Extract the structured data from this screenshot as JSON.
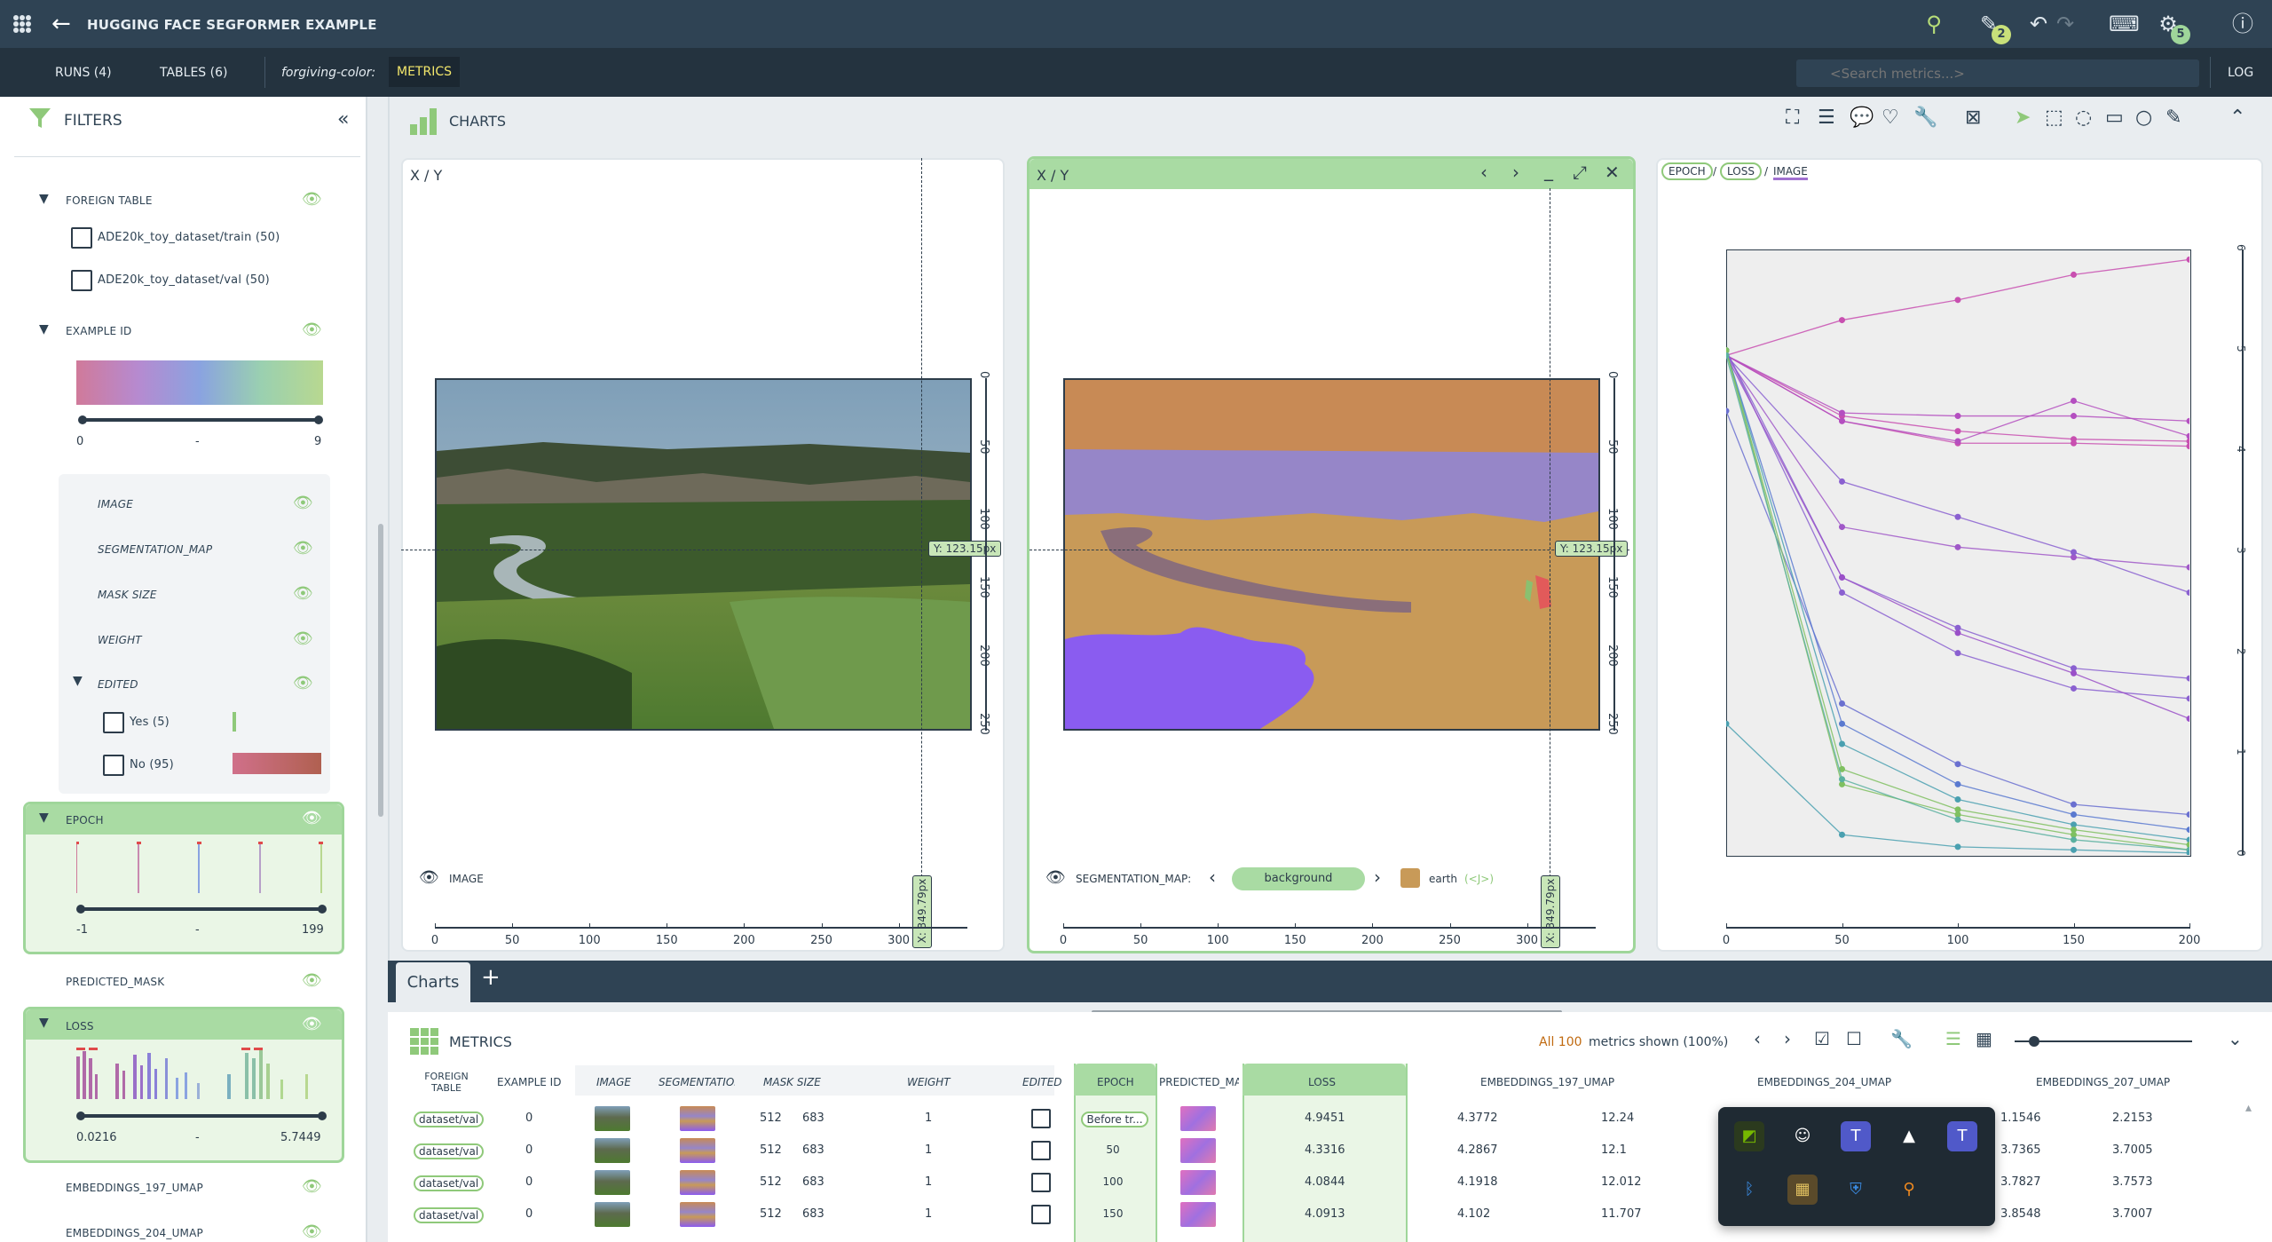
{
  "app": {
    "title": "HUGGING FACE SEGFORMER EXAMPLE",
    "badge_edits": "2",
    "badge_tasks": "5"
  },
  "subbar": {
    "runs": "RUNS (4)",
    "tables": "TABLES (6)",
    "coloring_label": "forgiving-color:",
    "coloring_value": "METRICS",
    "search_placeholder": "<Search metrics...>",
    "log": "LOG"
  },
  "filters": {
    "title": "FILTERS",
    "foreign_table": {
      "label": "FOREIGN TABLE",
      "options": [
        "ADE20k_toy_dataset/train (50)",
        "ADE20k_toy_dataset/val (50)"
      ]
    },
    "example_id": {
      "label": "EXAMPLE ID",
      "min": "0",
      "sep": "-",
      "max": "9"
    },
    "columns": [
      "IMAGE",
      "SEGMENTATION_MAP",
      "MASK SIZE",
      "WEIGHT"
    ],
    "edited": {
      "label": "EDITED",
      "yes": "Yes (5)",
      "no": "No (95)"
    },
    "epoch": {
      "label": "EPOCH",
      "min": "-1",
      "sep": "-",
      "max": "199"
    },
    "predicted_mask": "PREDICTED_MASK",
    "loss": {
      "label": "LOSS",
      "min": "0.0216",
      "sep": "-",
      "max": "5.7449"
    },
    "emb197": "EMBEDDINGS_197_UMAP",
    "emb204": "EMBEDDINGS_204_UMAP"
  },
  "charts": {
    "title": "CHARTS",
    "panel1": {
      "title": "X / Y",
      "legend": "IMAGE",
      "x_ticks": [
        "0",
        "50",
        "100",
        "150",
        "200",
        "250",
        "300"
      ],
      "y_ticks": [
        "0",
        "50",
        "100",
        "150",
        "200",
        "250"
      ],
      "cursor_x": "X: 349.79px",
      "cursor_y": "Y: 123.15px"
    },
    "panel2": {
      "title": "X / Y",
      "legend": "SEGMENTATION_MAP:",
      "class_selected": "background",
      "class_next": "earth",
      "class_next_tag": "(<J>)",
      "x_ticks": [
        "0",
        "50",
        "100",
        "150",
        "200",
        "250",
        "300"
      ],
      "y_ticks": [
        "0",
        "50",
        "100",
        "150",
        "200",
        "250"
      ],
      "cursor_x": "X: 349.79px",
      "cursor_y": "Y: 123.15px"
    },
    "panel3": {
      "crumbs": [
        "EPOCH",
        "LOSS",
        "IMAGE"
      ],
      "x_ticks": [
        "0",
        "50",
        "100",
        "150",
        "200"
      ],
      "y_ticks": [
        "6",
        "5",
        "4",
        "3",
        "2",
        "1",
        "0"
      ]
    }
  },
  "chart_data": {
    "type": "line",
    "x": [
      0,
      50,
      100,
      150,
      200
    ],
    "xlabel": "",
    "ylabel": "",
    "xlim": [
      0,
      200
    ],
    "ylim": [
      0,
      6
    ],
    "series": [
      {
        "color": "#c84fb0",
        "values": [
          4.95,
          5.3,
          5.5,
          5.75,
          5.9
        ]
      },
      {
        "color": "#c84fb0",
        "values": [
          4.95,
          4.35,
          4.2,
          4.12,
          4.1
        ]
      },
      {
        "color": "#c84fb0",
        "values": [
          4.95,
          4.3,
          4.08,
          4.08,
          4.05
        ]
      },
      {
        "color": "#b44fc0",
        "values": [
          4.95,
          4.38,
          4.35,
          4.35,
          4.3
        ]
      },
      {
        "color": "#b44fc0",
        "values": [
          4.95,
          4.3,
          4.1,
          4.5,
          4.15
        ]
      },
      {
        "color": "#a058c8",
        "values": [
          4.95,
          3.25,
          3.05,
          2.95,
          2.85
        ]
      },
      {
        "color": "#8a60d0",
        "values": [
          4.95,
          3.7,
          3.35,
          3.0,
          2.6
        ]
      },
      {
        "color": "#8a60d0",
        "values": [
          5.0,
          2.75,
          2.25,
          1.85,
          1.75
        ]
      },
      {
        "color": "#8a60d0",
        "values": [
          5.0,
          2.6,
          2.0,
          1.65,
          1.55
        ]
      },
      {
        "color": "#9a50c8",
        "values": [
          4.95,
          2.75,
          2.2,
          1.8,
          1.35
        ]
      },
      {
        "color": "#6a70d0",
        "values": [
          4.4,
          1.5,
          0.9,
          0.5,
          0.4
        ]
      },
      {
        "color": "#5a7ad0",
        "values": [
          5.0,
          1.3,
          0.7,
          0.4,
          0.25
        ]
      },
      {
        "color": "#4aa0b0",
        "values": [
          5.0,
          1.1,
          0.55,
          0.3,
          0.15
        ]
      },
      {
        "color": "#7fc060",
        "values": [
          5.0,
          0.85,
          0.45,
          0.25,
          0.1
        ]
      },
      {
        "color": "#7fc060",
        "values": [
          5.0,
          0.7,
          0.4,
          0.2,
          0.05
        ]
      },
      {
        "color": "#5ab0a0",
        "values": [
          4.95,
          0.75,
          0.35,
          0.15,
          0.05
        ]
      },
      {
        "color": "#4aa0b0",
        "values": [
          1.3,
          0.2,
          0.08,
          0.05,
          0.02
        ]
      }
    ]
  },
  "tabs": {
    "charts_tab": "Charts",
    "add": "+"
  },
  "metrics": {
    "title": "METRICS",
    "shown_prefix": "All 100",
    "shown_suffix": "metrics shown (100%)",
    "columns": [
      "FOREIGN TABLE",
      "EXAMPLE ID",
      "IMAGE",
      "SEGMENTATION_MAP",
      "MASK SIZE",
      "WEIGHT",
      "EDITED",
      "EPOCH",
      "PREDICTED_MASK",
      "LOSS",
      "EMBEDDINGS_197_UMAP",
      "EMBEDDINGS_204_UMAP",
      "EMBEDDINGS_207_UMAP"
    ],
    "rows": [
      {
        "table": "dataset/val",
        "id": "0",
        "mask_w": "512",
        "mask_h": "683",
        "weight": "1",
        "epoch": "Before tr...",
        "loss": "4.9451",
        "e197a": "4.3772",
        "e197b": "12.24",
        "e207a": "1.1546",
        "e207b": "2.2153"
      },
      {
        "table": "dataset/val",
        "id": "0",
        "mask_w": "512",
        "mask_h": "683",
        "weight": "1",
        "epoch": "50",
        "loss": "4.3316",
        "e197a": "4.2867",
        "e197b": "12.1",
        "e207a": "3.7365",
        "e207b": "3.7005"
      },
      {
        "table": "dataset/val",
        "id": "0",
        "mask_w": "512",
        "mask_h": "683",
        "weight": "1",
        "epoch": "100",
        "loss": "4.0844",
        "e197a": "4.1918",
        "e197b": "12.012",
        "e207a": "3.7827",
        "e207b": "3.7573"
      },
      {
        "table": "dataset/val",
        "id": "0",
        "mask_w": "512",
        "mask_h": "683",
        "weight": "1",
        "epoch": "150",
        "loss": "4.0913",
        "e197a": "4.102",
        "e197b": "11.707",
        "e207a": "3.8548",
        "e207b": "3.7007"
      }
    ]
  },
  "colors": {
    "accent_green": "#9fd69a",
    "topbar": "#2f4354",
    "subbar": "#24333f"
  }
}
